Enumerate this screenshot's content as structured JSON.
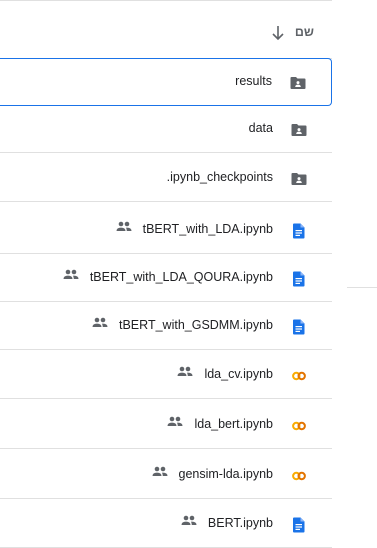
{
  "header": {
    "title": "שם"
  },
  "files": [
    {
      "name": "results",
      "type": "folder",
      "shared": false,
      "selected": true
    },
    {
      "name": "data",
      "type": "folder",
      "shared": false,
      "selected": false
    },
    {
      "name": ".ipynb_checkpoints",
      "type": "folder",
      "shared": false,
      "selected": false
    },
    {
      "name": "tBERT_with_LDA.ipynb",
      "type": "doc",
      "shared": true,
      "selected": false
    },
    {
      "name": "tBERT_with_LDA_QOURA.ipynb",
      "type": "doc",
      "shared": true,
      "selected": false
    },
    {
      "name": "tBERT_with_GSDMM.ipynb",
      "type": "doc",
      "shared": true,
      "selected": false
    },
    {
      "name": "lda_cv.ipynb",
      "type": "colab",
      "shared": true,
      "selected": false
    },
    {
      "name": "lda_bert.ipynb",
      "type": "colab",
      "shared": true,
      "selected": false
    },
    {
      "name": "gensim-lda.ipynb",
      "type": "colab",
      "shared": true,
      "selected": false
    },
    {
      "name": "BERT.ipynb",
      "type": "doc",
      "shared": true,
      "selected": false
    }
  ],
  "colors": {
    "folder": "#5f6368",
    "doc": "#1a73e8",
    "colab": "#f9ab00",
    "accent": "#1a73e8"
  },
  "icons": {
    "folder": "shared-folder-icon",
    "doc": "doc-file-icon",
    "colab": "colab-file-icon",
    "shared": "people-icon",
    "sort": "arrow-down-icon"
  }
}
